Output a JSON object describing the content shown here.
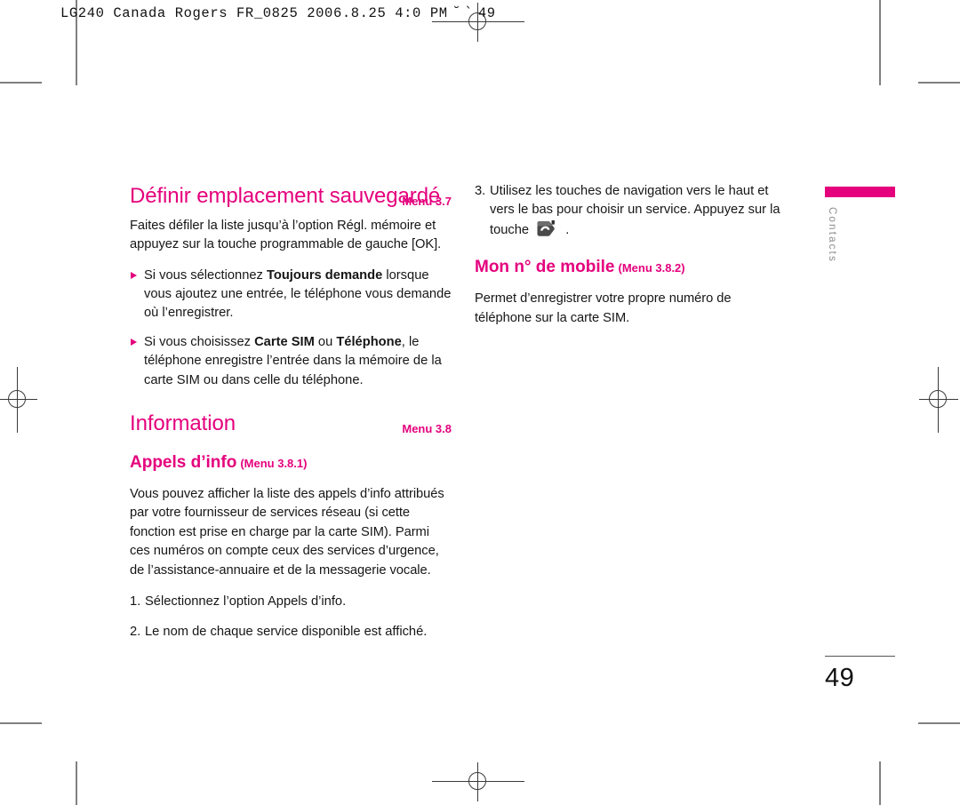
{
  "slug": {
    "text": "LG240 Canada Rogers FR_0825  2006.8.25 4:0 PM",
    "cjk_marks": "˘        `",
    "page_ref": "49"
  },
  "tab": {
    "label": "Contacts",
    "bar_color": "#e5007d"
  },
  "folio": {
    "page_number": "49"
  },
  "left_column": {
    "section_title": "Définir emplacement sauvegardé",
    "section_menu": "Menu 3.7",
    "intro": "Faites défiler la liste jusqu’à l’option Régl. mémoire et appuyez sur la touche programmable de gauche [OK].",
    "bullets": [
      {
        "pre": "Si vous sélectionnez ",
        "bold": "Toujours demande",
        "post": " lorsque vous ajoutez une entrée, le téléphone vous demande où l’enregistrer."
      },
      {
        "pre": "Si vous choisissez ",
        "bold": "Carte SIM",
        "mid": " ou ",
        "bold2": "Téléphone",
        "post": ", le téléphone enregistre l’entrée dans la mémoire de la carte SIM ou dans celle du téléphone."
      }
    ],
    "info_title": "Information",
    "info_menu": "Menu 3.8",
    "subsection_title": "Appels d’info",
    "subsection_menu": "(Menu 3.8.1)",
    "subsection_body": "Vous pouvez afficher la liste des appels d’info attribués par votre fournisseur de services réseau (si cette fonction est prise en charge par la carte SIM). Parmi ces numéros on compte ceux des services d’urgence, de l’assistance-annuaire et de la messagerie vocale.",
    "steps": [
      {
        "num": "1.",
        "text": "Sélectionnez l’option Appels d’info."
      },
      {
        "num": "2.",
        "text": "Le nom de chaque service disponible est affiché."
      }
    ]
  },
  "right_column": {
    "step": {
      "num": "3.",
      "text_before_icon": "Utilisez les touches de navigation vers le haut et vers le bas pour choisir un service. Appuyez sur la touche ",
      "icon_name": "send-key-icon",
      "text_after_icon": " ."
    },
    "subsection_title": "Mon n° de mobile",
    "subsection_menu": "(Menu 3.8.2)",
    "subsection_body": "Permet d’enregistrer votre propre numéro de téléphone sur la carte SIM."
  },
  "colors": {
    "accent": "#e5007d",
    "body_text": "#161616",
    "tab_text": "#8c8c8c",
    "marks": "#808080"
  }
}
